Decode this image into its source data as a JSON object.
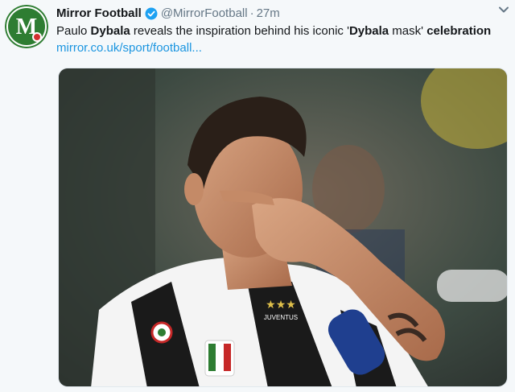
{
  "account": {
    "display_name": "Mirror Football",
    "handle": "@MirrorFootball",
    "separator": "·",
    "time": "27m",
    "avatar_letter": "M"
  },
  "tweet": {
    "text_parts": [
      {
        "t": "Paulo ",
        "b": false
      },
      {
        "t": "Dybala",
        "b": true
      },
      {
        "t": " reveals the inspiration behind his iconic '",
        "b": false
      },
      {
        "t": "Dybala",
        "b": true
      },
      {
        "t": " mask' ",
        "b": false
      },
      {
        "t": "celebration",
        "b": true
      }
    ],
    "link": "mirror.co.uk/sport/football..."
  },
  "media": {
    "shirt_text": "JUVENTUS"
  },
  "colors": {
    "link": "#1b95e0",
    "verified": "#1da1f2",
    "avatar_green": "#2e7d32",
    "muted": "#657786"
  },
  "icons": {
    "verified": "verified-badge-icon",
    "caret": "chevron-down-icon"
  }
}
